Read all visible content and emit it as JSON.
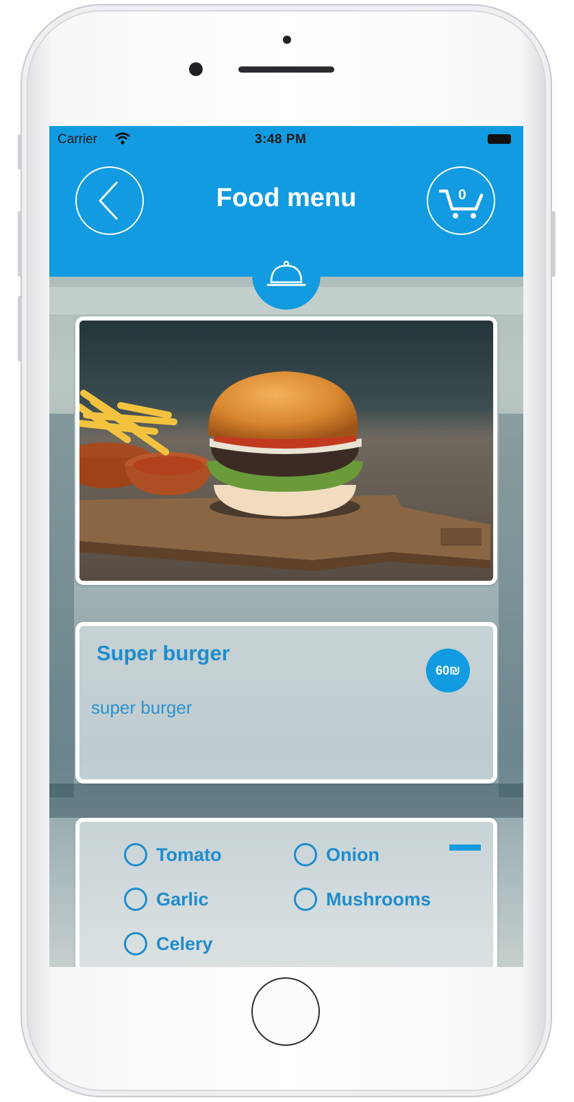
{
  "status_bar": {
    "carrier": "Carrier",
    "time": "3:48 PM"
  },
  "header": {
    "title": "Food menu",
    "back_icon": "chevron-left-icon",
    "cart_icon": "cart-icon",
    "cart_count": "0",
    "tab_icon": "cloche-icon"
  },
  "item": {
    "name": "Super burger",
    "description": "super burger",
    "price": "60₪",
    "image": "burger-with-fries-photo"
  },
  "options": [
    {
      "label": "Tomato",
      "selected": false
    },
    {
      "label": "Onion",
      "selected": false
    },
    {
      "label": "Garlic",
      "selected": false
    },
    {
      "label": "Mushrooms",
      "selected": false
    },
    {
      "label": "Celery",
      "selected": false
    }
  ],
  "colors": {
    "primary": "#129be0",
    "text_accent": "#1e8ccd",
    "card_border": "#ffffff"
  }
}
